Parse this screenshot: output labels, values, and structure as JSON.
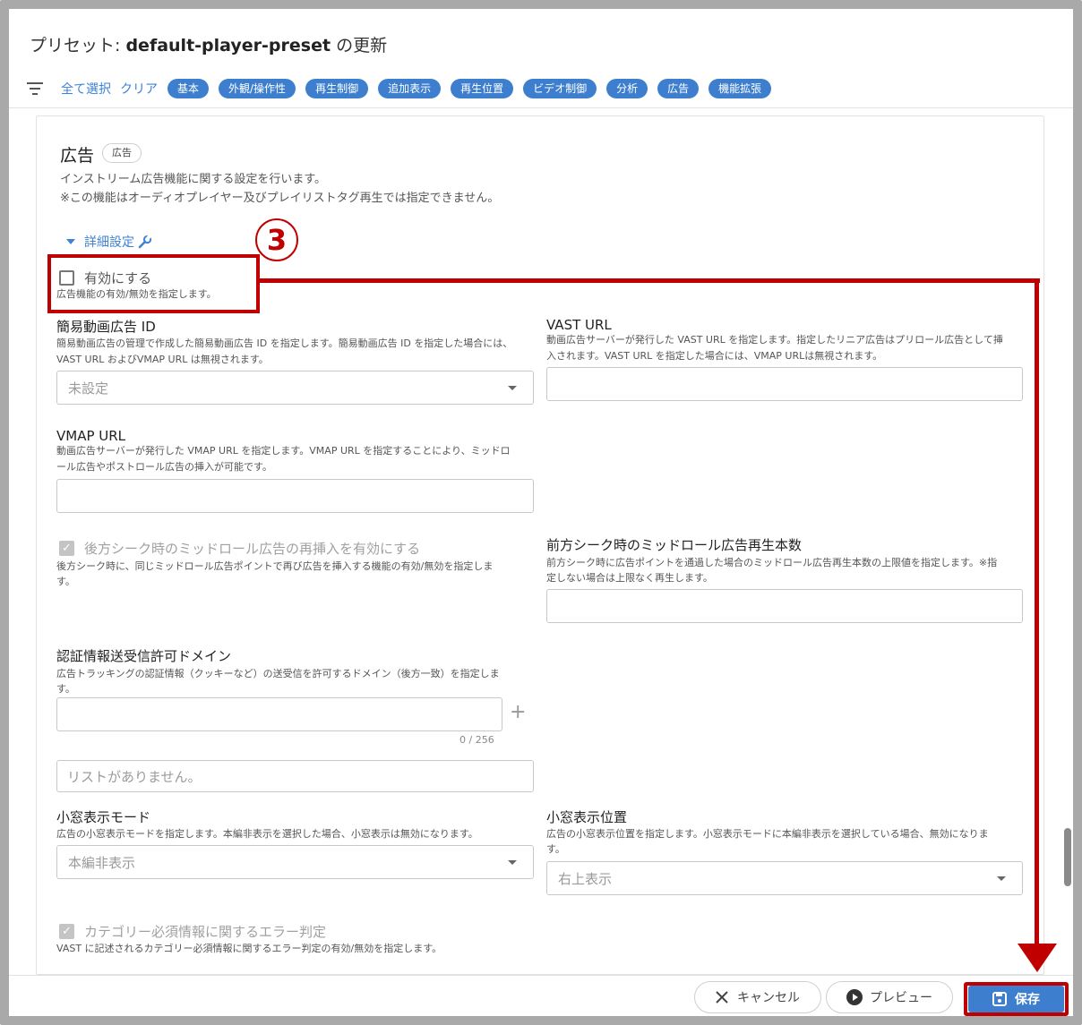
{
  "header": {
    "title_prefix": "プリセット: ",
    "preset_name": "default-player-preset",
    "title_suffix": " の更新"
  },
  "filterbar": {
    "select_all": "全て選択",
    "clear": "クリア",
    "chips": [
      "基本",
      "外観/操作性",
      "再生制御",
      "追加表示",
      "再生位置",
      "ビデオ制御",
      "分析",
      "広告",
      "機能拡張"
    ]
  },
  "section": {
    "title": "広告",
    "badge": "広告",
    "desc1": "インストリーム広告機能に関する設定を行います。",
    "desc2": "※この機能はオーディオプレイヤー及びプレイリストタグ再生では指定できません。",
    "detail": "詳細設定"
  },
  "annotation": {
    "step": "3"
  },
  "enable": {
    "label": "有効にする",
    "desc": "広告機能の有効/無効を指定します。"
  },
  "fields": {
    "simple_ad_id": {
      "label": "簡易動画広告 ID",
      "desc1": "簡易動画広告の管理で作成した簡易動画広告 ID を指定します。簡易動画広告 ID を指定した場合には、",
      "desc2": "VAST URL およびVMAP URL は無視されます。",
      "value": "未設定"
    },
    "vast_url": {
      "label": "VAST URL",
      "desc1": "動画広告サーバーが発行した VAST URL を指定します。指定したリニア広告はプリロール広告として挿",
      "desc2": "入されます。VAST URL を指定した場合には、VMAP URLは無視されます。"
    },
    "vmap_url": {
      "label": "VMAP URL",
      "desc1": "動画広告サーバーが発行した VMAP URL を指定します。VMAP URL を指定することにより、ミッドロ",
      "desc2": "ール広告やポストロール広告の挿入が可能です。"
    },
    "rear_seek": {
      "label": "後方シーク時のミッドロール広告の再挿入を有効にする",
      "desc1": "後方シーク時に、同じミッドロール広告ポイントで再び広告を挿入する機能の有効/無効を指定しま",
      "desc2": "す。"
    },
    "front_seek": {
      "label": "前方シーク時のミッドロール広告再生本数",
      "desc1": "前方シーク時に広告ポイントを通過した場合のミッドロール広告再生本数の上限値を指定します。※指",
      "desc2": "定しない場合は上限なく再生します。"
    },
    "auth_domain": {
      "label": "認証情報送受信許可ドメイン",
      "desc1": "広告トラッキングの認証情報（クッキーなど）の送受信を許可するドメイン（後方一致）を指定しま",
      "desc2": "す。",
      "counter": "0 / 256",
      "empty": "リストがありません。"
    },
    "mini_mode": {
      "label": "小窓表示モード",
      "desc": "広告の小窓表示モードを指定します。本編非表示を選択した場合、小窓表示は無効になります。",
      "value": "本編非表示"
    },
    "mini_position": {
      "label": "小窓表示位置",
      "desc1": "広告の小窓表示位置を指定します。小窓表示モードに本編非表示を選択している場合、無効になりま",
      "desc2": "す。",
      "value": "右上表示"
    },
    "category_error": {
      "label": "カテゴリー必須情報に関するエラー判定",
      "desc": "VAST に記述されるカテゴリー必須情報に関するエラー判定の有効/無効を指定します。"
    }
  },
  "footer": {
    "cancel": "キャンセル",
    "preview": "プレビュー",
    "save": "保存"
  },
  "colors": {
    "accent": "#3d7fce",
    "annotation": "#c00000"
  }
}
